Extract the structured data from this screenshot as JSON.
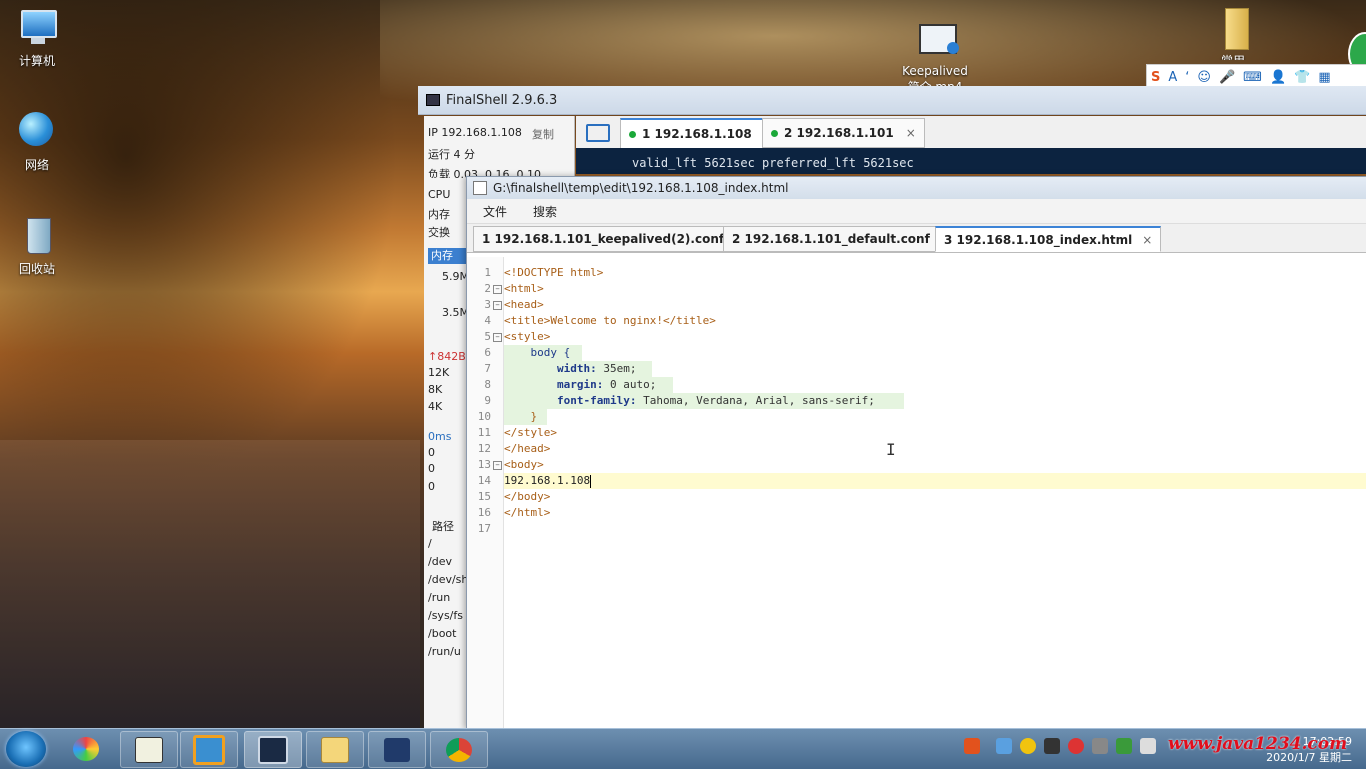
{
  "desktop": {
    "icons": [
      {
        "label": "计算机"
      },
      {
        "label": "网络"
      },
      {
        "label": "回收站"
      },
      {
        "label": "Keepalived",
        "sub": "简介.mp4"
      },
      {
        "label": "常用"
      }
    ]
  },
  "finalshell": {
    "title": "FinalShell 2.9.6.3",
    "ip": "IP 192.168.1.108",
    "copy": "复制",
    "uptime": "运行 4 分",
    "load": "负载 0.03, 0.16, 0.10",
    "cpu": "CPU",
    "mem": "内存",
    "swap": "交换",
    "mem_header": "内存",
    "mem_vals": [
      "5.9M",
      "3.5M"
    ],
    "net_up": "842B",
    "net_scale": [
      "12K",
      "8K",
      "4K"
    ],
    "ping": "0ms",
    "ping_vals": [
      "0",
      "0",
      "0"
    ],
    "path_header": "路径",
    "paths": [
      "/",
      "/dev",
      "/dev/sh",
      "/run",
      "/sys/fs",
      "/boot",
      "/run/u"
    ],
    "tabs": [
      {
        "label": "1 192.168.1.108",
        "close": "×"
      },
      {
        "label": "2 192.168.1.101",
        "close": "×"
      }
    ],
    "terminal_line": "valid_lft 5621sec preferred_lft 5621sec"
  },
  "editor": {
    "title": "G:\\finalshell\\temp\\edit\\192.168.1.108_index.html",
    "menu": [
      "文件",
      "搜索"
    ],
    "tabs": [
      {
        "label": "1 192.168.1.101_keepalived(2).conf",
        "close": "×"
      },
      {
        "label": "2 192.168.1.101_default.conf",
        "close": "×"
      },
      {
        "label": "3 192.168.1.108_index.html",
        "close": "×"
      }
    ],
    "lines": [
      "<!DOCTYPE html>",
      "<html>",
      "<head>",
      "<title>Welcome to nginx!</title>",
      "<style>",
      "    body {",
      "        width: 35em;",
      "        margin: 0 auto;",
      "        font-family: Tahoma, Verdana, Arial, sans-serif;",
      "    }",
      "</style>",
      "</head>",
      "<body>",
      "192.168.1.108",
      "</body>",
      "</html>",
      ""
    ]
  },
  "ime": {
    "labels": [
      "S",
      "A",
      "ʻ",
      "☺",
      "🎤",
      "⌨",
      "👤",
      "👕",
      "▦"
    ]
  },
  "taskbar": {
    "clock_time": "17:02:59",
    "clock_date": "2020/1/7 星期二",
    "watermark": "www.java1234.com"
  },
  "colors": {
    "accent": "#3c83d6",
    "terminal_bg": "#0c2340",
    "status_green": "#1aa839"
  }
}
